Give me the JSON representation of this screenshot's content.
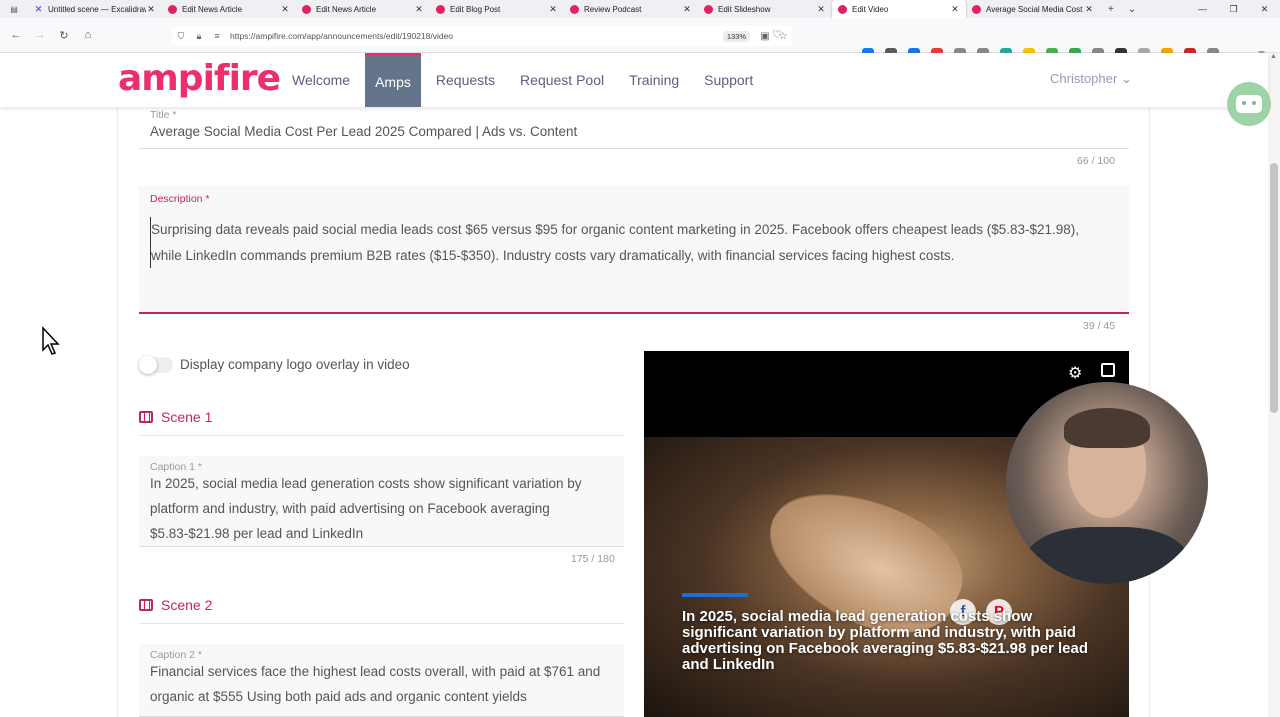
{
  "browser": {
    "tabs": [
      {
        "label": "Untitled scene — Excalidraw",
        "icon": "excalidraw-icon",
        "active": false
      },
      {
        "label": "Edit News Article",
        "icon": "ampifire-icon",
        "active": false
      },
      {
        "label": "Edit News Article",
        "icon": "ampifire-icon",
        "active": false
      },
      {
        "label": "Edit Blog Post",
        "icon": "ampifire-icon",
        "active": false
      },
      {
        "label": "Review Podcast",
        "icon": "ampifire-icon",
        "active": false
      },
      {
        "label": "Edit Slideshow",
        "icon": "ampifire-icon",
        "active": false
      },
      {
        "label": "Edit Video",
        "icon": "ampifire-icon",
        "active": true
      },
      {
        "label": "Average Social Media Cost",
        "icon": "ampifire-icon",
        "active": false
      }
    ],
    "url": "https://ampifire.com/app/announcements/edit/190218/video",
    "zoom": "133%",
    "extension_colors": [
      "#1877f2",
      "#5b5b5b",
      "#1a73e8",
      "#e53935",
      "#888888",
      "#888888",
      "#26a69a",
      "#fbbc04",
      "#4caf50",
      "#34a853",
      "#888888",
      "#333333",
      "#aaaaaa",
      "#f4a100",
      "#c62828",
      "#888888"
    ]
  },
  "app": {
    "logo": "ampifire",
    "nav": [
      {
        "label": "Welcome",
        "active": false
      },
      {
        "label": "Amps",
        "active": true
      },
      {
        "label": "Requests",
        "active": false
      },
      {
        "label": "Request Pool",
        "active": false
      },
      {
        "label": "Training",
        "active": false
      },
      {
        "label": "Support",
        "active": false
      }
    ],
    "user": "Christopher"
  },
  "form": {
    "title_label": "Title *",
    "title_value": "Average Social Media Cost Per Lead 2025 Compared | Ads vs. Content",
    "title_counter": "66 / 100",
    "description_label": "Description *",
    "description_value": "Surprising data reveals paid social media leads cost $65 versus $95 for organic content marketing in 2025. Facebook offers cheapest leads ($5.83-$21.98), while LinkedIn commands premium B2B rates ($15-$350). Industry costs vary dramatically, with financial services facing highest costs.",
    "description_counter": "39 / 45",
    "logo_overlay_label": "Display company logo overlay in video",
    "logo_overlay_on": false
  },
  "scenes": [
    {
      "heading": "Scene 1",
      "caption_label": "Caption 1 *",
      "caption": "In 2025, social media lead generation costs show significant variation by platform and industry, with paid advertising on Facebook averaging $5.83-$21.98 per lead and LinkedIn",
      "counter": "175 / 180"
    },
    {
      "heading": "Scene 2",
      "caption_label": "Caption 2 *",
      "caption": "Financial services face the highest lead costs overall, with paid at $761 and organic at $555 Using both paid ads and organic content yields"
    }
  ],
  "video": {
    "caption": "In 2025, social media lead generation costs show significant variation by platform and industry, with paid advertising on Facebook averaging $5.83-$21.98 per lead and LinkedIn",
    "accent": "#1d6fd8"
  },
  "colors": {
    "brand": "#ec2f6a",
    "required": "#c0265c",
    "nav_active_bg": "#64748b"
  }
}
